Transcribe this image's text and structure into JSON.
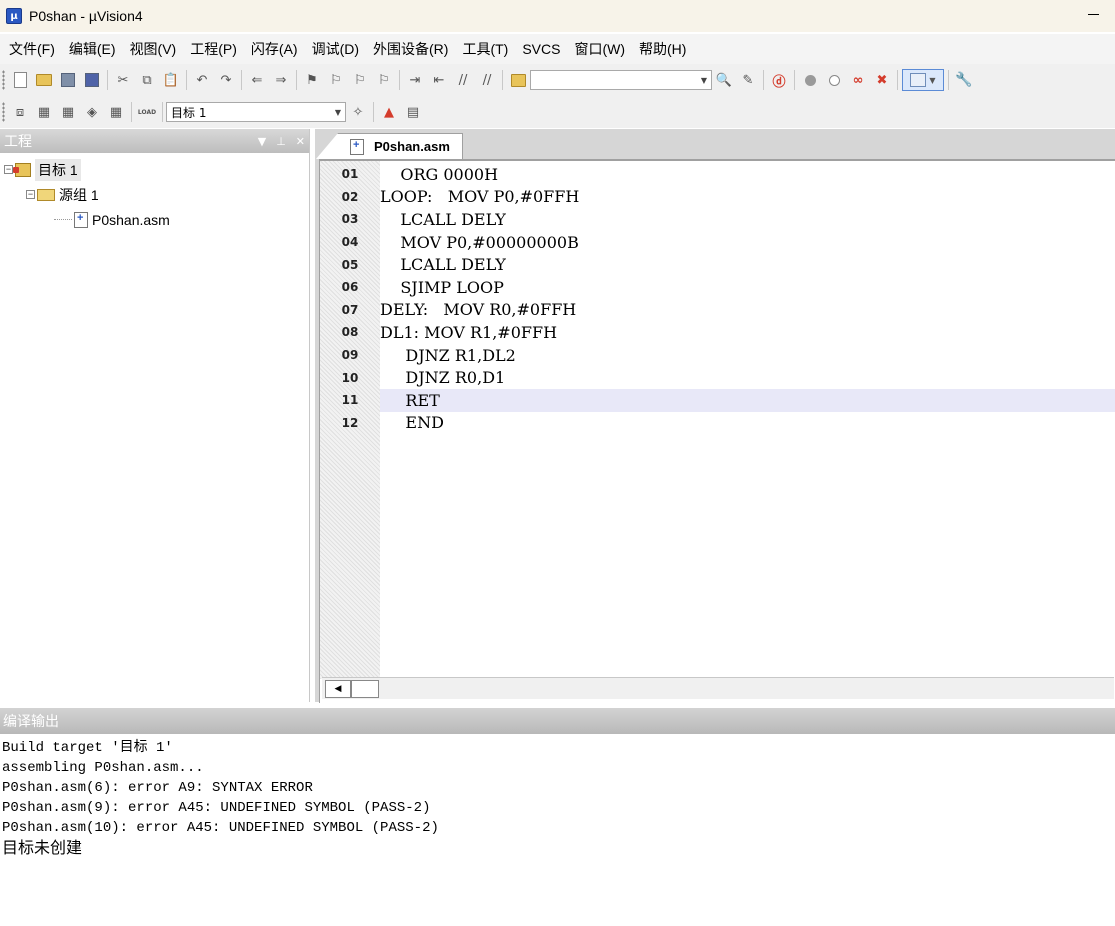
{
  "window": {
    "title": "P0shan  - µVision4"
  },
  "menu": [
    "文件(F)",
    "编辑(E)",
    "视图(V)",
    "工程(P)",
    "闪存(A)",
    "调试(D)",
    "外围设备(R)",
    "工具(T)",
    "SVCS",
    "窗口(W)",
    "帮助(H)"
  ],
  "toolbar2": {
    "target_combo": "目标 1",
    "load_label": "LOAD"
  },
  "project_panel": {
    "title": "工程",
    "tree": {
      "target": "目标 1",
      "group": "源组 1",
      "file": "P0shan.asm"
    }
  },
  "editor": {
    "tab_label": "P0shan.asm",
    "current_line": 11,
    "lines": [
      {
        "num": "01",
        "text": "    ORG 0000H"
      },
      {
        "num": "02",
        "text": "LOOP:   MOV P0,#0FFH"
      },
      {
        "num": "03",
        "text": "    LCALL DELY"
      },
      {
        "num": "04",
        "text": "    MOV P0,#00000000B"
      },
      {
        "num": "05",
        "text": "    LCALL DELY"
      },
      {
        "num": "06",
        "text": "    SJIMP LOOP"
      },
      {
        "num": "07",
        "text": "DELY:   MOV R0,#0FFH"
      },
      {
        "num": "08",
        "text": "DL1: MOV R1,#0FFH"
      },
      {
        "num": "09",
        "text": "     DJNZ R1,DL2"
      },
      {
        "num": "10",
        "text": "     DJNZ R0,D1"
      },
      {
        "num": "11",
        "text": "     RET"
      },
      {
        "num": "12",
        "text": "     END"
      }
    ]
  },
  "output": {
    "title": "编译输出",
    "lines": [
      "Build target '目标 1'",
      "assembling P0shan.asm...",
      "P0shan.asm(6): error A9: SYNTAX ERROR",
      "P0shan.asm(9): error A45: UNDEFINED SYMBOL (PASS-2)",
      "P0shan.asm(10): error A45: UNDEFINED SYMBOL (PASS-2)"
    ],
    "final_line": "目标未创建"
  }
}
